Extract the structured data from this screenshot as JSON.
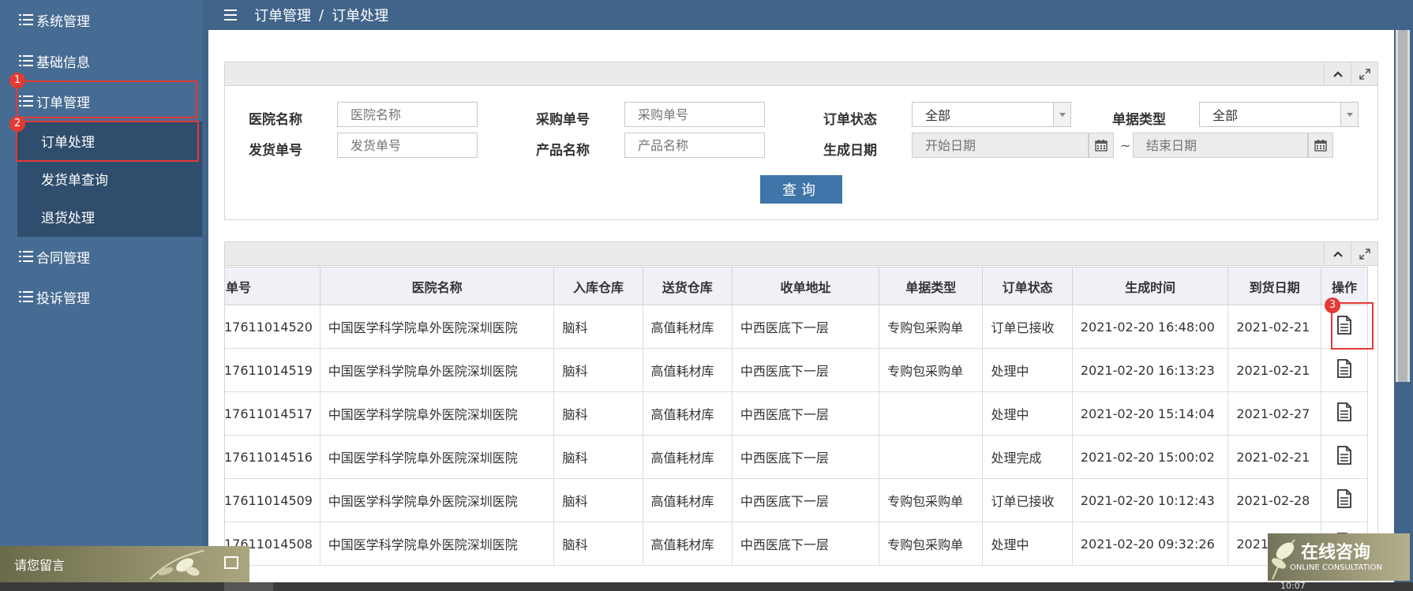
{
  "sidebar": {
    "items": [
      {
        "label": "系统管理"
      },
      {
        "label": "基础信息"
      },
      {
        "label": "订单管理"
      },
      {
        "label": "合同管理"
      },
      {
        "label": "投诉管理"
      }
    ],
    "sub_items": [
      {
        "label": "订单处理"
      },
      {
        "label": "发货单查询"
      },
      {
        "label": "退货处理"
      }
    ],
    "badges": [
      "1",
      "2",
      "3"
    ]
  },
  "breadcrumb": {
    "parent": "订单管理",
    "separator": "/",
    "current": "订单处理"
  },
  "search": {
    "hospital_label": "医院名称",
    "hospital_placeholder": "医院名称",
    "purchase_label": "采购单号",
    "purchase_placeholder": "采购单号",
    "status_label": "订单状态",
    "status_value": "全部",
    "doctype_label": "单据类型",
    "doctype_value": "全部",
    "ship_label": "发货单号",
    "ship_placeholder": "发货单号",
    "product_label": "产品名称",
    "product_placeholder": "产品名称",
    "date_label": "生成日期",
    "start_placeholder": "开始日期",
    "date_sep": "~",
    "end_placeholder": "结束日期",
    "query_label": "查询"
  },
  "table": {
    "headers": [
      "单号",
      "医院名称",
      "入库仓库",
      "送货仓库",
      "收单地址",
      "单据类型",
      "订单状态",
      "生成时间",
      "到货日期",
      "操作"
    ],
    "rows": [
      [
        "17611014520",
        "中国医学科学院阜外医院深圳医院",
        "脑科",
        "高值耗材库",
        "中西医底下一层",
        "专购包采购单",
        "订单已接收",
        "2021-02-20 16:48:00",
        "2021-02-21"
      ],
      [
        "17611014519",
        "中国医学科学院阜外医院深圳医院",
        "脑科",
        "高值耗材库",
        "中西医底下一层",
        "专购包采购单",
        "处理中",
        "2021-02-20 16:13:23",
        "2021-02-21"
      ],
      [
        "17611014517",
        "中国医学科学院阜外医院深圳医院",
        "脑科",
        "高值耗材库",
        "中西医底下一层",
        "",
        "处理中",
        "2021-02-20 15:14:04",
        "2021-02-27"
      ],
      [
        "17611014516",
        "中国医学科学院阜外医院深圳医院",
        "脑科",
        "高值耗材库",
        "中西医底下一层",
        "",
        "处理完成",
        "2021-02-20 15:00:02",
        "2021-02-21"
      ],
      [
        "17611014509",
        "中国医学科学院阜外医院深圳医院",
        "脑科",
        "高值耗材库",
        "中西医底下一层",
        "专购包采购单",
        "订单已接收",
        "2021-02-20 10:12:43",
        "2021-02-28"
      ],
      [
        "17611014508",
        "中国医学科学院阜外医院深圳医院",
        "脑科",
        "高值耗材库",
        "中西医底下一层",
        "专购包采购单",
        "处理中",
        "2021-02-20 09:32:26",
        "2021-02-27"
      ]
    ]
  },
  "widgets": {
    "leave_message": "请您留言",
    "consult_cn": "在线咨询",
    "consult_en": "ONLINE CONSULTATION",
    "bottom_text": "10:07"
  },
  "colors": {
    "sidebar_bg": "#476c93",
    "submenu_bg": "#2f4d6c",
    "accent_button": "#3f75a9",
    "highlight_red": "#e53935"
  }
}
